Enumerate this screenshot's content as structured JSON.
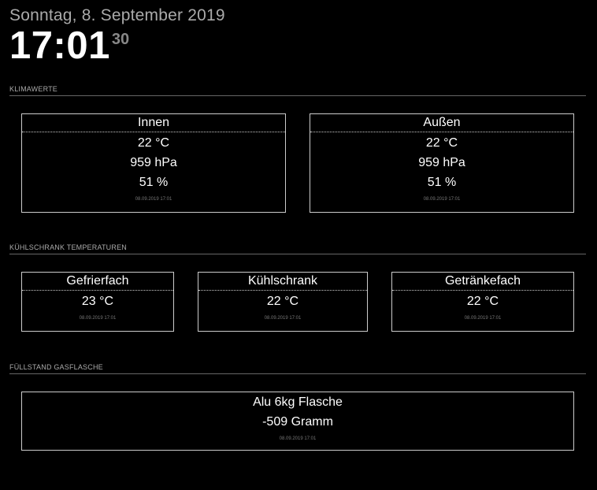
{
  "header": {
    "date": "Sonntag, 8. September 2019",
    "time": "17:01",
    "seconds": "30"
  },
  "sections": {
    "klima": {
      "title": "KLIMAWERTE",
      "cards": [
        {
          "title": "Innen",
          "values": [
            "22 °C",
            "959 hPa",
            "51 %"
          ],
          "timestamp": "08.09.2019 17:01"
        },
        {
          "title": "Außen",
          "values": [
            "22 °C",
            "959 hPa",
            "51 %"
          ],
          "timestamp": "08.09.2019 17:01"
        }
      ]
    },
    "kuehl": {
      "title": "KÜHLSCHRANK TEMPERATUREN",
      "cards": [
        {
          "title": "Gefrierfach",
          "values": [
            "23 °C"
          ],
          "timestamp": "08.09.2019 17:01"
        },
        {
          "title": "Kühlschrank",
          "values": [
            "22 °C"
          ],
          "timestamp": "08.09.2019 17:01"
        },
        {
          "title": "Getränkefach",
          "values": [
            "22 °C"
          ],
          "timestamp": "08.09.2019 17:01"
        }
      ]
    },
    "gas": {
      "title": "FÜLLSTAND GASFLASCHE",
      "cards": [
        {
          "title": "Alu 6kg Flasche",
          "values": [
            "-509 Gramm"
          ],
          "timestamp": "08.09.2019 17:01"
        }
      ]
    }
  }
}
